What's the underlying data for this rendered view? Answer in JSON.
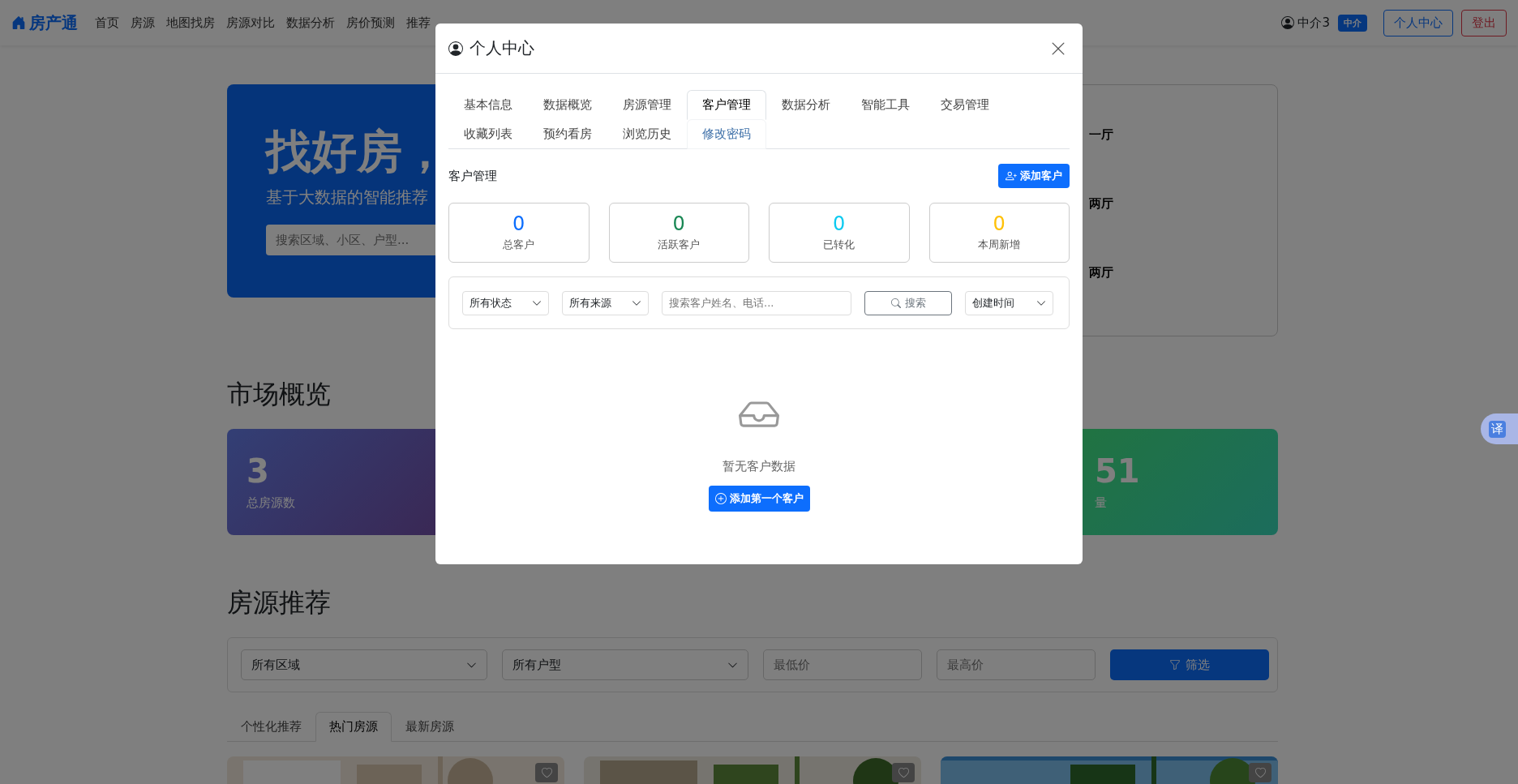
{
  "navbar": {
    "brand": "房产通",
    "links": [
      {
        "label": "首页"
      },
      {
        "label": "房源"
      },
      {
        "label": "地图找房"
      },
      {
        "label": "房源对比"
      },
      {
        "label": "数据分析"
      },
      {
        "label": "房价预测"
      },
      {
        "label": "推荐"
      }
    ],
    "user": "中介3",
    "role_badge": "中介",
    "buttons": [
      {
        "label": "个人中心",
        "kind": "outline-primary"
      },
      {
        "label": "登出",
        "kind": "outline-danger"
      }
    ]
  },
  "hero": {
    "title": "找好房，",
    "subtitle": "基于大数据的智能推荐",
    "search_placeholder": "搜索区域、小区、户型...",
    "side_items": [
      "一厅",
      "两厅",
      "两厅"
    ]
  },
  "market": {
    "title": "市场概览",
    "cards": [
      {
        "value": "3",
        "label": "总房源数",
        "kind": "indigo"
      },
      {
        "value": "51",
        "label": "量",
        "kind": "green"
      }
    ]
  },
  "recommend": {
    "title": "房源推荐",
    "selects": [
      "所有区域",
      "所有户型"
    ],
    "inputs": [
      {
        "placeholder": "最低价"
      },
      {
        "placeholder": "最高价"
      }
    ],
    "filter_button": "筛选",
    "tabs": [
      {
        "label": "个性化推荐",
        "selected": false
      },
      {
        "label": "热门房源",
        "selected": true
      },
      {
        "label": "最新房源",
        "selected": false
      }
    ],
    "listings": [
      {
        "kind": "picture",
        "favorited": false
      },
      {
        "kind": "picture",
        "favorited": false
      },
      {
        "kind": "picture",
        "favorited": false
      }
    ]
  },
  "modal": {
    "title": "个人中心",
    "tabs": [
      {
        "label": "基本信息",
        "selected": false,
        "hovered": false
      },
      {
        "label": "数据概览",
        "selected": false,
        "hovered": false
      },
      {
        "label": "房源管理",
        "selected": false,
        "hovered": false
      },
      {
        "label": "客户管理",
        "selected": true,
        "hovered": false
      },
      {
        "label": "数据分析",
        "selected": false,
        "hovered": false
      },
      {
        "label": "智能工具",
        "selected": false,
        "hovered": false
      },
      {
        "label": "交易管理",
        "selected": false,
        "hovered": false
      },
      {
        "label": "收藏列表",
        "selected": false,
        "hovered": false
      },
      {
        "label": "预约看房",
        "selected": false,
        "hovered": false
      },
      {
        "label": "浏览历史",
        "selected": false,
        "hovered": false
      },
      {
        "label": "修改密码",
        "selected": false,
        "hovered": true
      }
    ],
    "section_title": "客户管理",
    "add_button": "添加客户",
    "stats": [
      {
        "value": "0",
        "label": "总客户",
        "color": "#0d6efd"
      },
      {
        "value": "0",
        "label": "活跃客户",
        "color": "#198754"
      },
      {
        "value": "0",
        "label": "已转化",
        "color": "#0dcaf0"
      },
      {
        "value": "0",
        "label": "本周新增",
        "color": "#ffc107"
      }
    ],
    "filters": {
      "status": "所有状态",
      "source": "所有来源",
      "search_placeholder": "搜索客户姓名、电话...",
      "search_button": "搜索",
      "sort": "创建时间"
    },
    "empty": {
      "message": "暂无客户数据",
      "button": "添加第一个客户"
    }
  },
  "translate_button": "译"
}
